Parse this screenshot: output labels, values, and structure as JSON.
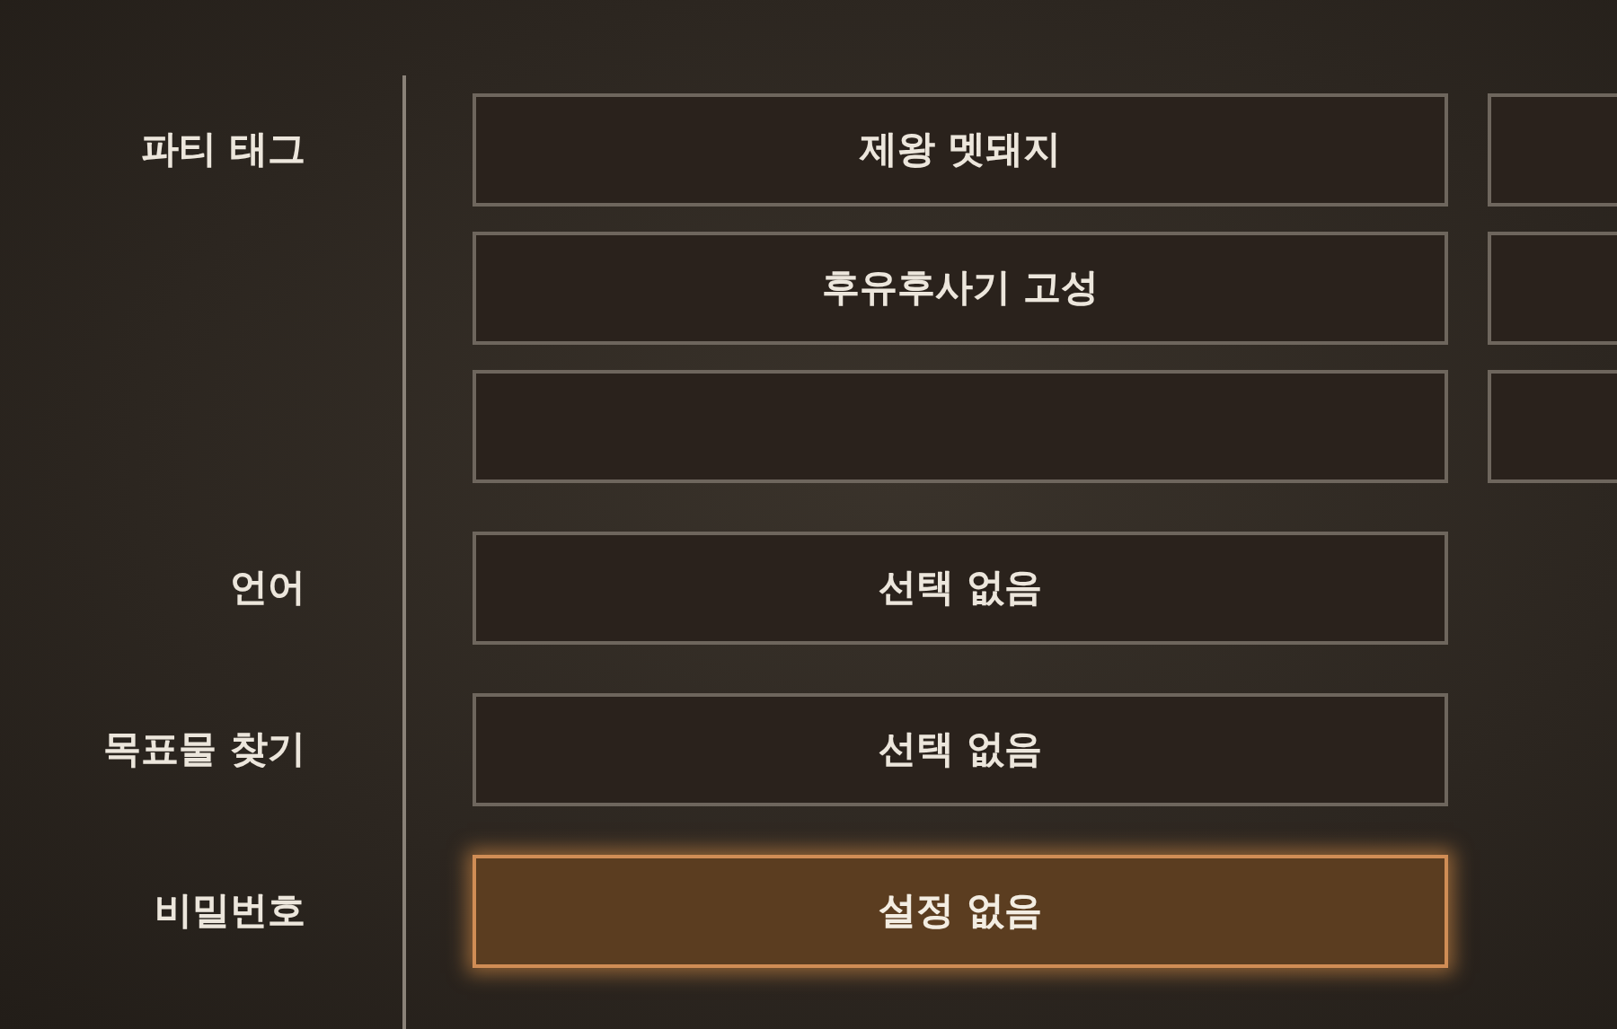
{
  "settings": [
    {
      "label": "파티 태그",
      "kind": "tag_group",
      "slots": [
        {
          "value": "제왕 멧돼지",
          "selected": false
        },
        {
          "value": "후유후사기 고성",
          "selected": false
        },
        {
          "selected": false
        }
      ]
    },
    {
      "label": "언어",
      "kind": "option",
      "value": "선택 없음",
      "selected": false
    },
    {
      "label": "목표물 찾기",
      "kind": "option",
      "value": "선택 없음",
      "selected": false
    },
    {
      "label": "비밀번호",
      "kind": "option",
      "value": "설정 없음",
      "selected": true
    }
  ]
}
